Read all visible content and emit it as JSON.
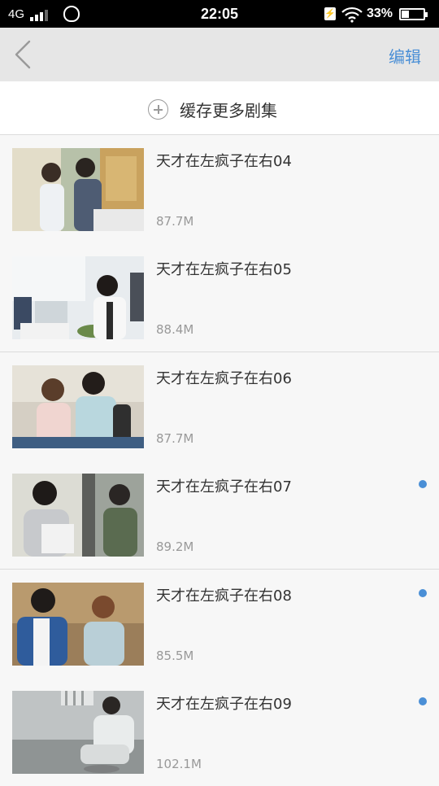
{
  "status_bar": {
    "network": "4G",
    "time": "22:05",
    "battery_percent": "33%",
    "battery_level": 0.33
  },
  "header": {
    "edit_label": "编辑"
  },
  "cache_more": {
    "label": "缓存更多剧集"
  },
  "episodes": [
    {
      "title": "天才在左疯子在右04",
      "size": "87.7M",
      "unwatched": false
    },
    {
      "title": "天才在左疯子在右05",
      "size": "88.4M",
      "unwatched": false
    },
    {
      "title": "天才在左疯子在右06",
      "size": "87.7M",
      "unwatched": false
    },
    {
      "title": "天才在左疯子在右07",
      "size": "89.2M",
      "unwatched": true
    },
    {
      "title": "天才在左疯子在右08",
      "size": "85.5M",
      "unwatched": true
    },
    {
      "title": "天才在左疯子在右09",
      "size": "102.1M",
      "unwatched": true
    }
  ],
  "colors": {
    "accent": "#4a8fd6"
  }
}
